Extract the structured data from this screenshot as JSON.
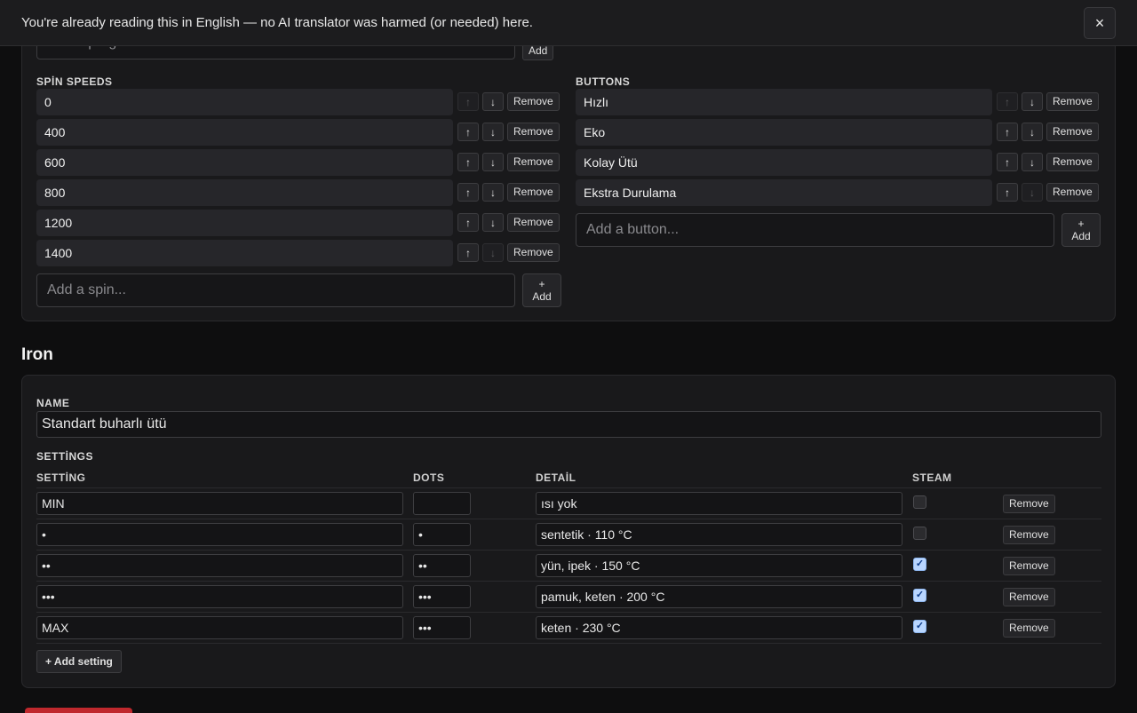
{
  "banner": {
    "text": "You're already reading this in English — no AI translator was harmed (or needed) here.",
    "close_icon": "×"
  },
  "top_card": {
    "program_placeholder": "Add a programme...",
    "program_add_label": "Add",
    "spin": {
      "heading": "SPİN SPEEDS",
      "items": [
        "0",
        "400",
        "600",
        "800",
        "1200",
        "1400"
      ],
      "add_placeholder": "Add a spin...",
      "add_label_plus": "+",
      "add_label": "Add"
    },
    "buttons": {
      "heading": "BUTTONS",
      "items": [
        "Hızlı",
        "Eko",
        "Kolay Ütü",
        "Ekstra Durulama"
      ],
      "add_placeholder": "Add a button...",
      "add_label_plus": "+",
      "add_label": "Add"
    },
    "up_icon": "↑",
    "down_icon": "↓",
    "remove_label": "Remove"
  },
  "iron": {
    "title": "Iron",
    "name_label": "NAME",
    "name_value": "Standart buharlı ütü",
    "settings_label": "SETTİNGS",
    "columns": {
      "setting": "SETTİNG",
      "dots": "DOTS",
      "detail": "DETAİL",
      "steam": "STEAM"
    },
    "rows": [
      {
        "setting": "MIN",
        "dots": "",
        "detail": "ısı yok",
        "steam": false
      },
      {
        "setting": "•",
        "dots": "•",
        "detail": "sentetik · 110 °C",
        "steam": false
      },
      {
        "setting": "••",
        "dots": "••",
        "detail": "yün, ipek · 150 °C",
        "steam": true
      },
      {
        "setting": "•••",
        "dots": "•••",
        "detail": "pamuk, keten · 200 °C",
        "steam": true
      },
      {
        "setting": "MAX",
        "dots": "•••",
        "detail": "keten · 230 °C",
        "steam": true
      }
    ],
    "remove_label": "Remove",
    "add_setting_label": "+ Add setting",
    "check_icon": "✓"
  },
  "colors": {
    "background": "#0e0e0f",
    "card": "#19191b",
    "checkbox_checked": "#b9d6ff",
    "bottom_button": "#c0282d"
  }
}
